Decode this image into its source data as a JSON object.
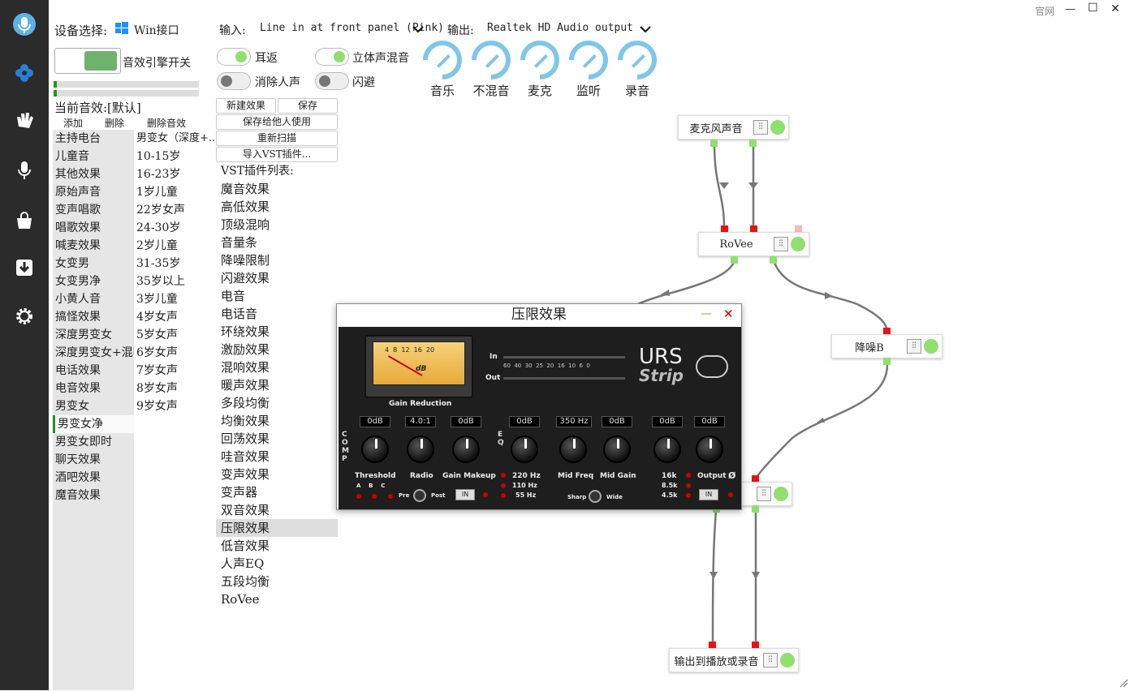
{
  "window": {
    "title_link": "官网",
    "min": "—",
    "max": "☐",
    "close": "✕"
  },
  "sidebar": {
    "icons": [
      "microphone-logo-icon",
      "flower-icon",
      "clap-hands-icon",
      "microphone-icon",
      "shopping-bag-icon",
      "download-icon",
      "gear-icon"
    ]
  },
  "device": {
    "label": "设备选择:",
    "value": "Win接口"
  },
  "engine": {
    "label": "音效引擎开关"
  },
  "io": {
    "input_label": "输入:",
    "input_value": "Line in at front panel (Pink)",
    "output_label": "输出:",
    "output_value": "Realtek HD Audio output"
  },
  "toggles": [
    {
      "label": "耳返",
      "state": "on"
    },
    {
      "label": "立体声混音",
      "state": "on"
    },
    {
      "label": "消除人声",
      "state": "off"
    },
    {
      "label": "闪避",
      "state": "off"
    }
  ],
  "knobs": [
    "音乐",
    "不混音",
    "麦克",
    "监听",
    "录音"
  ],
  "current_effect": "当前音效:[默认]",
  "effect_actions": [
    "添加",
    "删除",
    "删除音效"
  ],
  "effects_left": [
    "主持电台",
    "儿童音",
    "其他效果",
    "原始声音",
    "变声唱歌",
    "唱歌效果",
    "喊麦效果",
    "女变男",
    "女变男净",
    "小黄人音",
    "搞怪效果",
    "深度男变女",
    "深度男变女+混响",
    "电话效果",
    "电音效果",
    "男变女",
    "男变女净",
    "男变女即时",
    "聊天效果",
    "酒吧效果",
    "魔音效果"
  ],
  "effects_right": [
    "男变女（深度+...",
    "10-15岁",
    "16-23岁",
    "1岁儿童",
    "22岁女声",
    "24-30岁",
    "2岁儿童",
    "31-35岁",
    "35岁以上",
    "3岁儿童",
    "4岁女声",
    "5岁女声",
    "6岁女声",
    "7岁女声",
    "8岁女声",
    "9岁女声"
  ],
  "vst_buttons": {
    "new": "新建效果",
    "save": "保存",
    "save_share": "保存给他人使用",
    "rescan": "重新扫描",
    "import": "导入VST插件..."
  },
  "vst_header": "VST插件列表:",
  "vst_list": [
    "魔音效果",
    "高低效果",
    "顶级混响",
    "音量条",
    "降噪限制",
    "闪避效果",
    "电音",
    "电话音",
    "环绕效果",
    "激励效果",
    "混响效果",
    "暖声效果",
    "多段均衡",
    "均衡效果",
    "回荡效果",
    "哇音效果",
    "变声效果",
    "变声器",
    "双音效果",
    "压限效果",
    "低音效果",
    "人声EQ",
    "五段均衡",
    "RoVee"
  ],
  "vst_selected": "压限效果",
  "nodes": {
    "mic": "麦克风声音",
    "rovee": "RoVee",
    "denoise": "降噪B",
    "output": "输出到播放或录音",
    "btn": "⫶⫶"
  },
  "plugin": {
    "title": "压限效果",
    "min": "—",
    "close": "✕",
    "brand": "URS",
    "brand2": "Strip",
    "meter_label": "Gain Reduction",
    "in": "In",
    "out": "Out",
    "scale": "60  40  30  25  20  16  10  6  0",
    "vu_scale": "4  8  12  16  20",
    "vu_db": "dB",
    "comp": "COMP",
    "eq": "EQ",
    "lcds": [
      "0dB",
      "4.0:1",
      "0dB",
      "0dB",
      "350 Hz",
      "0dB",
      "0dB",
      "0dB"
    ],
    "knob_labels": [
      "Threshold",
      "Radio",
      "Gain Makeup",
      "220 Hz",
      "Mid Freq",
      "Mid Gain",
      "16k",
      "Output"
    ],
    "abc": "A    B    C",
    "pre": "Pre",
    "post": "Post",
    "in_btn": "IN",
    "hz2": "110 Hz",
    "hz3": "55 Hz",
    "sharp": "Sharp",
    "wide": "Wide",
    "k2": "8.5k",
    "k3": "4.5k",
    "phase": "Ø"
  }
}
